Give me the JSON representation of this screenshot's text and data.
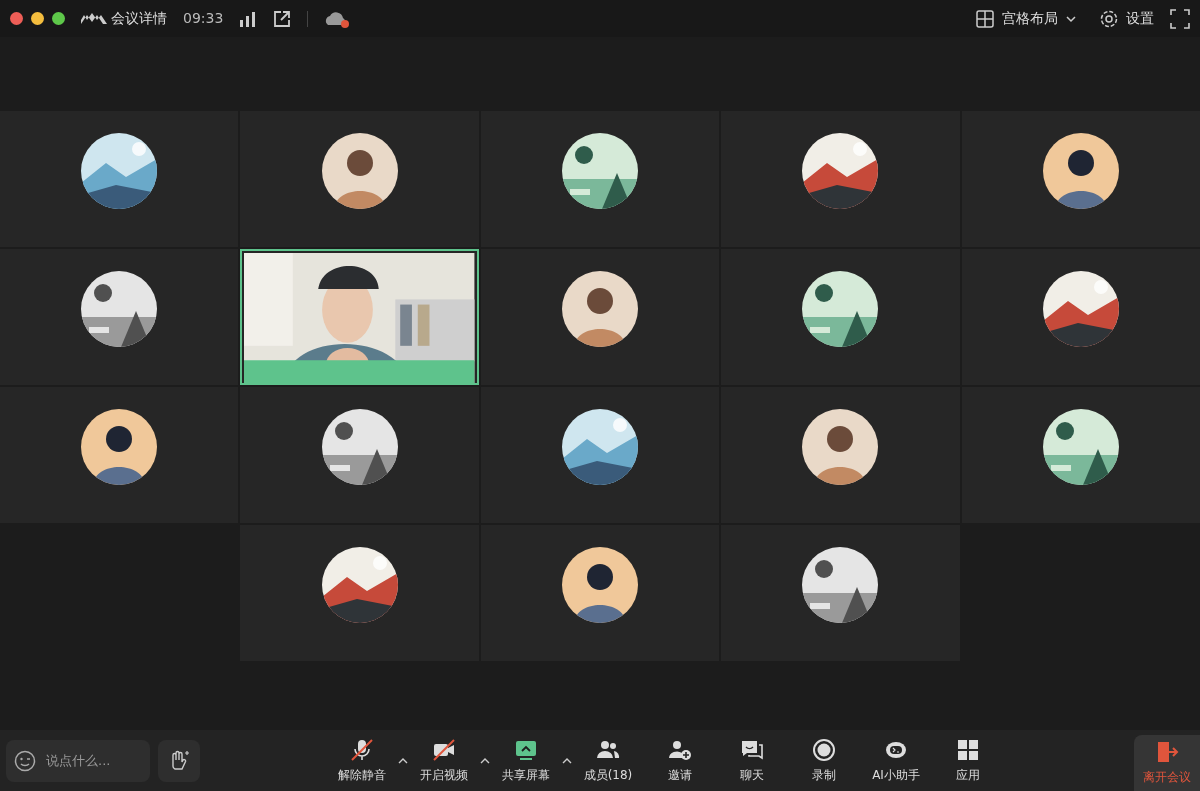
{
  "title_bar": {
    "title": "会议详情",
    "time": "09:33",
    "layout_button": "宫格布局",
    "settings_button": "设置"
  },
  "tiles": [
    {
      "kind": "avatar",
      "speaking": false
    },
    {
      "kind": "avatar",
      "speaking": false
    },
    {
      "kind": "avatar",
      "speaking": false
    },
    {
      "kind": "avatar",
      "speaking": false
    },
    {
      "kind": "avatar",
      "speaking": false
    },
    {
      "kind": "avatar",
      "speaking": false
    },
    {
      "kind": "video",
      "speaking": true
    },
    {
      "kind": "avatar",
      "speaking": false
    },
    {
      "kind": "avatar",
      "speaking": false
    },
    {
      "kind": "avatar",
      "speaking": false
    },
    {
      "kind": "avatar",
      "speaking": false
    },
    {
      "kind": "avatar",
      "speaking": false
    },
    {
      "kind": "avatar",
      "speaking": false
    },
    {
      "kind": "avatar",
      "speaking": false
    },
    {
      "kind": "avatar",
      "speaking": false
    },
    {
      "kind": "avatar",
      "speaking": false
    },
    {
      "kind": "avatar",
      "speaking": false
    },
    {
      "kind": "avatar",
      "speaking": false
    }
  ],
  "toolbar": {
    "chat": {
      "placeholder": "说点什么..."
    },
    "controls": [
      {
        "kind": "mic",
        "label": "解除静音",
        "caret": true,
        "off": true
      },
      {
        "kind": "camera",
        "label": "开启视频",
        "caret": true,
        "off": true
      },
      {
        "kind": "share",
        "label": "共享屏幕",
        "caret": true,
        "off": false
      },
      {
        "kind": "members",
        "label": "成员(18)",
        "caret": false,
        "off": false
      },
      {
        "kind": "invite",
        "label": "邀请",
        "caret": false,
        "off": false
      },
      {
        "kind": "chat",
        "label": "聊天",
        "caret": false,
        "off": false
      },
      {
        "kind": "record",
        "label": "录制",
        "caret": false,
        "off": false
      },
      {
        "kind": "assistant",
        "label": "AI小助手",
        "caret": false,
        "off": false
      },
      {
        "kind": "apps",
        "label": "应用",
        "caret": false,
        "off": false
      }
    ],
    "leave_button": "离开会议"
  }
}
